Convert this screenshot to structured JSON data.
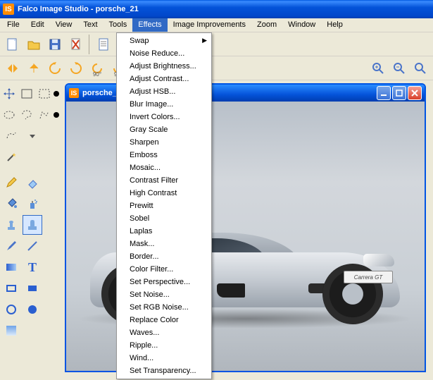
{
  "window": {
    "title": "Falco Image Studio - porsche_21",
    "app_icon_letter": "IS"
  },
  "menubar": {
    "items": [
      "File",
      "Edit",
      "View",
      "Text",
      "Tools",
      "Effects",
      "Image Improvements",
      "Zoom",
      "Window",
      "Help"
    ],
    "active_index": 5
  },
  "effects_menu": {
    "items": [
      {
        "label": "Swap",
        "submenu": true
      },
      {
        "label": "Noise Reduce..."
      },
      {
        "label": "Adjust Brightness..."
      },
      {
        "label": "Adjust Contrast..."
      },
      {
        "label": "Adjust HSB..."
      },
      {
        "label": "Blur Image..."
      },
      {
        "label": "Invert Colors..."
      },
      {
        "label": "Gray Scale"
      },
      {
        "label": "Sharpen"
      },
      {
        "label": "Emboss"
      },
      {
        "label": "Mosaic..."
      },
      {
        "label": "Contrast Filter"
      },
      {
        "label": "High Contrast"
      },
      {
        "label": "Prewitt"
      },
      {
        "label": "Sobel"
      },
      {
        "label": "Laplas"
      },
      {
        "label": "Mask..."
      },
      {
        "label": "Border..."
      },
      {
        "label": "Color Filter..."
      },
      {
        "label": "Set Perspective..."
      },
      {
        "label": "Set Noise..."
      },
      {
        "label": "Set RGB Noise..."
      },
      {
        "label": "Replace Color"
      },
      {
        "label": "Waves..."
      },
      {
        "label": "Ripple..."
      },
      {
        "label": "Wind..."
      },
      {
        "label": "Set Transparency..."
      }
    ]
  },
  "toolbar1": {
    "icons": [
      "new-file-icon",
      "open-file-icon",
      "save-file-icon",
      "delete-page-icon",
      "properties-icon"
    ]
  },
  "toolbar2": {
    "icons": [
      "flip-h-icon",
      "flip-v-icon",
      "rotate-ccw-icon",
      "rotate-cw-icon",
      "rotate-90-ccw-icon",
      "rotate-90-cw-icon",
      "rotate-free-icon"
    ],
    "labels": {
      "rotate-90-ccw-icon": "90°",
      "rotate-90-cw-icon": "90°"
    },
    "zoom_icons": [
      "zoom-in-icon",
      "zoom-out-icon",
      "zoom-fit-icon"
    ]
  },
  "toolbox": {
    "tools": [
      [
        "move-icon",
        "marquee-rect-icon",
        "marquee-dashed-icon"
      ],
      [
        "ellipse-select-icon",
        "lasso-icon",
        "polyline-select-icon"
      ],
      [
        "freehand-select-icon",
        "dropdown-icon",
        ""
      ],
      [
        "magic-wand-icon",
        "",
        ""
      ],
      [
        "pencil-icon",
        "eraser-icon",
        ""
      ],
      [
        "bucket-icon",
        "spray-icon",
        ""
      ],
      [
        "stamp-icon",
        "clone-icon",
        ""
      ],
      [
        "brush-icon",
        "line-icon",
        ""
      ],
      [
        "gradient-rect-icon",
        "text-icon",
        ""
      ],
      [
        "rectangle-icon",
        "filled-rect-icon",
        ""
      ],
      [
        "circle-icon",
        "filled-circle-icon",
        ""
      ],
      [
        "gradient-swatch-icon",
        "",
        ""
      ]
    ],
    "selected": "clone-icon",
    "color_dots": [
      "#000000",
      "#000000"
    ]
  },
  "child_window": {
    "title": "porsche_",
    "icon_letter": "IS",
    "plate_text": "Carrera GT"
  },
  "colors": {
    "xp_blue": "#0453d9",
    "menu_highlight": "#316ac5",
    "panel_bg": "#ece9d8"
  }
}
